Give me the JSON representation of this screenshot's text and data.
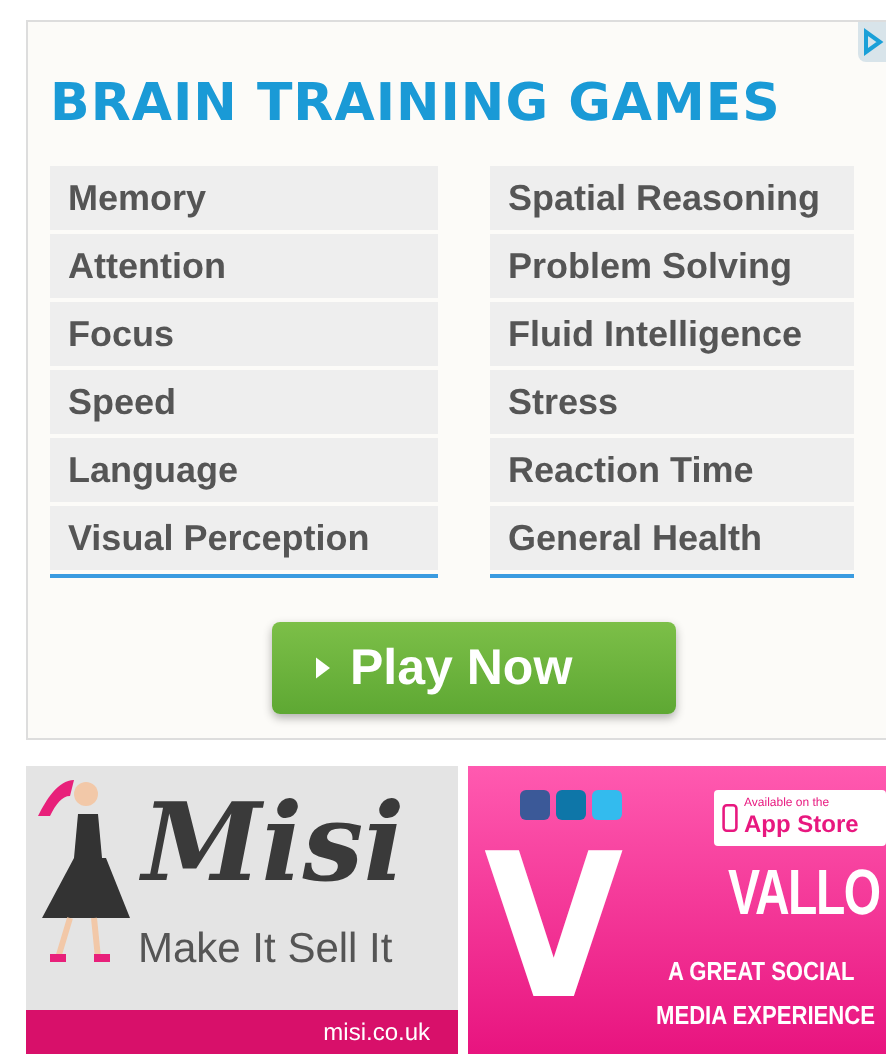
{
  "title": "BRAIN TRAINING GAMES",
  "columns": [
    {
      "items": [
        "Memory",
        "Attention",
        "Focus",
        "Speed",
        "Language",
        "Visual Perception"
      ]
    },
    {
      "items": [
        "Spatial Reasoning",
        "Problem Solving",
        "Fluid Intelligence",
        "Stress",
        "Reaction Time",
        "General Health"
      ]
    }
  ],
  "play_button": {
    "label": "Play Now"
  },
  "ads": [
    {
      "kind": "misi",
      "logo": "Misi",
      "tagline": "Make It Sell It",
      "url": "misi.co.uk"
    },
    {
      "kind": "vallo",
      "letter": "V",
      "badge_small": "Available on the",
      "badge_large": "App Store",
      "name": "VALLO",
      "line_1": "A GREAT SOCIAL",
      "line_2": "MEDIA EXPERIENCE"
    }
  ]
}
